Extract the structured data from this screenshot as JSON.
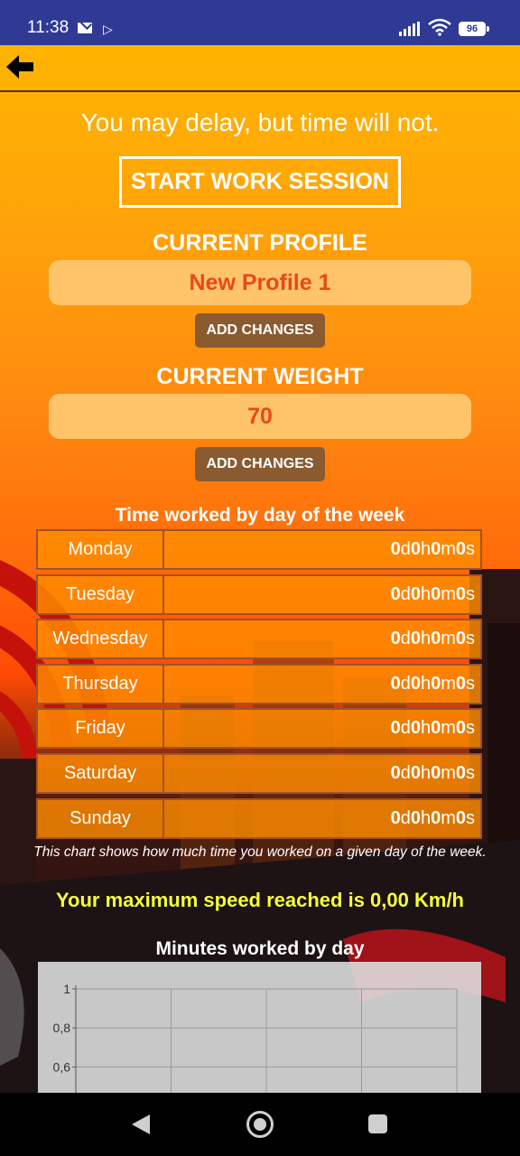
{
  "status_bar": {
    "time": "11:38",
    "battery": "96",
    "icons": [
      "mail-icon",
      "play-icon",
      "signal-icon",
      "wifi-icon",
      "battery-icon"
    ]
  },
  "toolbar": {
    "back_icon": "arrow-left-icon"
  },
  "quote": "You may delay, but time will not.",
  "start_button": "START WORK SESSION",
  "profile": {
    "title": "CURRENT PROFILE",
    "value": "New Profile 1",
    "button": "ADD CHANGES"
  },
  "weight": {
    "title": "CURRENT WEIGHT",
    "value": "70",
    "button": "ADD CHANGES"
  },
  "week_table": {
    "title": "Time worked by day of the week",
    "rows": [
      {
        "day": "Monday",
        "d": "0",
        "h": "0",
        "m": "0",
        "s": "0"
      },
      {
        "day": "Tuesday",
        "d": "0",
        "h": "0",
        "m": "0",
        "s": "0"
      },
      {
        "day": "Wednesday",
        "d": "0",
        "h": "0",
        "m": "0",
        "s": "0"
      },
      {
        "day": "Thursday",
        "d": "0",
        "h": "0",
        "m": "0",
        "s": "0"
      },
      {
        "day": "Friday",
        "d": "0",
        "h": "0",
        "m": "0",
        "s": "0"
      },
      {
        "day": "Saturday",
        "d": "0",
        "h": "0",
        "m": "0",
        "s": "0"
      },
      {
        "day": "Sunday",
        "d": "0",
        "h": "0",
        "m": "0",
        "s": "0"
      }
    ],
    "note": "This chart shows how much time you worked on a given day of the week."
  },
  "max_speed": "Your maximum speed reached is 0,00 Km/h",
  "minutes_chart": {
    "title": "Minutes worked by day",
    "y_ticks": [
      "1",
      "0,8",
      "0,6"
    ]
  },
  "chart_data": {
    "type": "line",
    "title": "Minutes worked by day",
    "ylim": [
      0.6,
      1
    ],
    "y_tick_labels": [
      "1",
      "0,8",
      "0,6"
    ],
    "grid": true,
    "series": []
  },
  "nav_bar": {
    "icons": [
      "nav-back-icon",
      "nav-home-icon",
      "nav-recents-icon"
    ]
  }
}
